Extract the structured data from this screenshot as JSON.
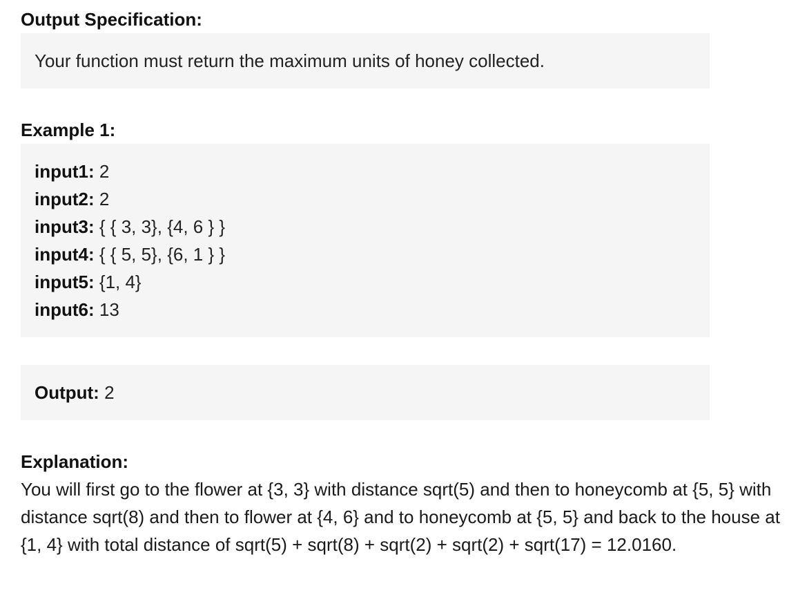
{
  "output_spec": {
    "heading": "Output Specification:",
    "text": "Your function must return the maximum units of honey collected."
  },
  "example": {
    "heading": "Example 1:",
    "inputs": [
      {
        "key": "input1:",
        "value": " 2"
      },
      {
        "key": "input2:",
        "value": " 2"
      },
      {
        "key": "input3:",
        "value": " { { 3, 3}, {4, 6 } }"
      },
      {
        "key": "input4:",
        "value": " { { 5, 5}, {6, 1 } }"
      },
      {
        "key": "input5:",
        "value": " {1, 4}"
      },
      {
        "key": "input6:",
        "value": " 13"
      }
    ],
    "output": {
      "key": "Output:",
      "value": " 2"
    }
  },
  "explanation": {
    "heading": "Explanation:",
    "text": "You will first go to the flower at {3, 3} with distance sqrt(5) and then to honeycomb at {5, 5} with distance sqrt(8) and then to flower at {4, 6} and to honeycomb at {5, 5} and back to the house at {1, 4} with total distance of sqrt(5) + sqrt(8) + sqrt(2) + sqrt(2) + sqrt(17) = 12.0160."
  }
}
